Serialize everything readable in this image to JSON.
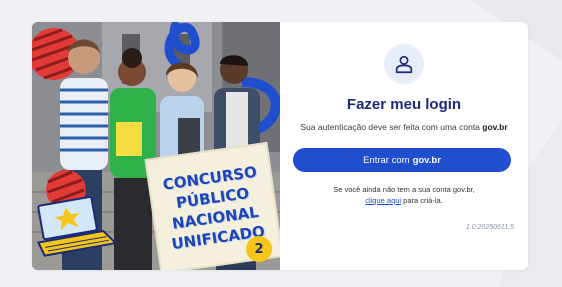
{
  "hero": {
    "contest_lines": [
      "CONCURSO",
      "PÚBLICO",
      "NACIONAL",
      "UNIFICADO"
    ],
    "edition": "2"
  },
  "login": {
    "title": "Fazer meu login",
    "subtitle_prefix": "Sua autenticação deve ser feita com uma conta",
    "subtitle_brand": "gov.br",
    "button_prefix": "Entrar com",
    "button_brand": "gov.br",
    "no_account_text": "Se você ainda não tem a sua conta gov.br,",
    "signup_link": "clique aqui",
    "signup_suffix": "para criá-la.",
    "version": "1.0.20250611.5"
  },
  "colors": {
    "primary": "#1f4fcf",
    "title": "#1c2b78",
    "background": "#f0f1f4"
  },
  "icons": {
    "user": "user-icon"
  }
}
